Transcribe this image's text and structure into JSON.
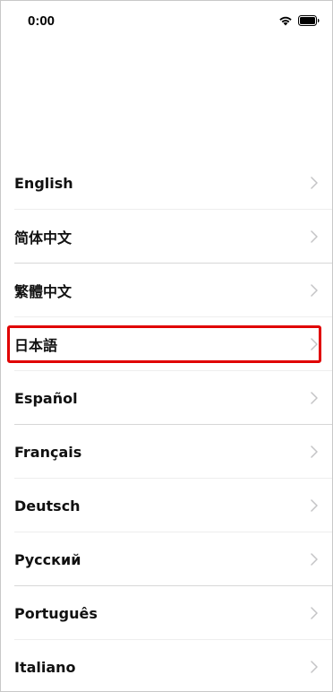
{
  "status_bar": {
    "time": "0:00",
    "icons": [
      "wifi-icon",
      "battery-icon"
    ]
  },
  "languages": [
    {
      "label": "English",
      "icon": "chevron-right-icon"
    },
    {
      "label": "简体中文",
      "icon": "chevron-right-icon"
    },
    {
      "label": "繁體中文",
      "icon": "chevron-right-icon"
    },
    {
      "label": "日本語",
      "icon": "chevron-right-icon",
      "highlighted": true
    },
    {
      "label": "Español",
      "icon": "chevron-right-icon"
    },
    {
      "label": "Français",
      "icon": "chevron-right-icon"
    },
    {
      "label": "Deutsch",
      "icon": "chevron-right-icon"
    },
    {
      "label": "Русский",
      "icon": "chevron-right-icon"
    },
    {
      "label": "Português",
      "icon": "chevron-right-icon"
    },
    {
      "label": "Italiano",
      "icon": "chevron-right-icon"
    }
  ],
  "colors": {
    "highlight": "#e00000",
    "text": "#111111",
    "chevron": "#c4c4c6"
  }
}
